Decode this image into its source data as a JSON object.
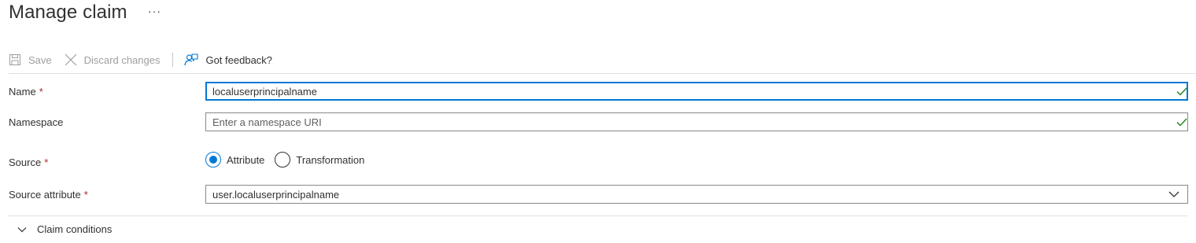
{
  "header": {
    "title": "Manage claim",
    "more_label": "···"
  },
  "toolbar": {
    "save_label": "Save",
    "discard_label": "Discard changes",
    "feedback_label": "Got feedback?"
  },
  "form": {
    "name": {
      "label": "Name",
      "required_mark": "*",
      "value": "localuserprincipalname"
    },
    "namespace": {
      "label": "Namespace",
      "placeholder": "Enter a namespace URI",
      "value": ""
    },
    "source": {
      "label": "Source",
      "required_mark": "*",
      "options": [
        "Attribute",
        "Transformation"
      ],
      "selected": "Attribute"
    },
    "source_attribute": {
      "label": "Source attribute",
      "required_mark": "*",
      "value": "user.localuserprincipalname"
    }
  },
  "conditions": {
    "label": "Claim conditions"
  },
  "colors": {
    "accent": "#0078d4",
    "success": "#107c10",
    "required": "#a4262c",
    "disabled": "#a19f9d"
  }
}
